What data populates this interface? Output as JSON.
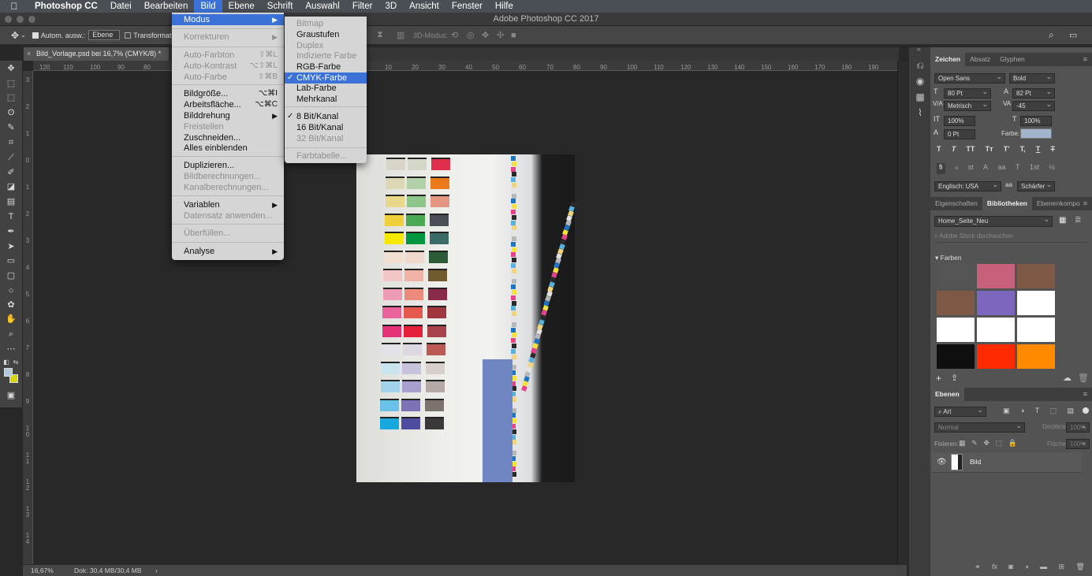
{
  "menubar": {
    "apple_icon": "apple-icon",
    "app_name": "Photoshop CC",
    "items": [
      "Datei",
      "Bearbeiten",
      "Bild",
      "Ebene",
      "Schrift",
      "Auswahl",
      "Filter",
      "3D",
      "Ansicht",
      "Fenster",
      "Hilfe"
    ]
  },
  "window": {
    "title": "Adobe Photoshop CC 2017"
  },
  "options": {
    "auto_select": "Autom. ausw.:",
    "layer_select": "Ebene",
    "transform": "Transformat",
    "mode_3d": "3D-Modus:"
  },
  "document": {
    "tab_title": "Bild_Vorlage.psd bei 16,7% (CMYK/8) *",
    "close_glyph": "×"
  },
  "ruler": {
    "h_ticks": [
      "120",
      "110",
      "100",
      "90",
      "80",
      "10",
      "20",
      "30",
      "40",
      "50",
      "60",
      "70",
      "80",
      "90",
      "100",
      "110",
      "120",
      "130",
      "140",
      "150",
      "160",
      "170",
      "180",
      "190"
    ],
    "v_ticks": [
      "3",
      "2",
      "1",
      "0",
      "1",
      "2",
      "3",
      "4",
      "5",
      "6",
      "7",
      "8",
      "9",
      "1 0",
      "1 1",
      "1 2",
      "1 3",
      "1 4"
    ]
  },
  "status": {
    "zoom": "16,67%",
    "doc": "Dok: 30,4 MB/30,4 MB",
    "arrow": "›"
  },
  "bild_menu": {
    "items": [
      {
        "label": "Modus",
        "submenu": true,
        "highlight": true
      },
      {
        "label": "Korrekturen",
        "submenu": true,
        "disabled": true
      },
      {
        "label": "Auto-Farbton",
        "shortcut": "⇧⌘L",
        "disabled": true
      },
      {
        "label": "Auto-Kontrast",
        "shortcut": "⌥⇧⌘L",
        "disabled": true
      },
      {
        "label": "Auto-Farbe",
        "shortcut": "⇧⌘B",
        "disabled": true
      },
      {
        "label": "Bildgröße...",
        "shortcut": "⌥⌘I"
      },
      {
        "label": "Arbeitsfläche...",
        "shortcut": "⌥⌘C"
      },
      {
        "label": "Bilddrehung",
        "submenu": true
      },
      {
        "label": "Freistellen",
        "disabled": true
      },
      {
        "label": "Zuschneiden..."
      },
      {
        "label": "Alles einblenden"
      },
      {
        "label": "Duplizieren..."
      },
      {
        "label": "Bildberechnungen...",
        "disabled": true
      },
      {
        "label": "Kanalberechnungen...",
        "disabled": true
      },
      {
        "label": "Variablen",
        "submenu": true
      },
      {
        "label": "Datensatz anwenden...",
        "disabled": true
      },
      {
        "label": "Überfüllen...",
        "disabled": true
      },
      {
        "label": "Analyse",
        "submenu": true
      }
    ],
    "submenu_arrow": "▶"
  },
  "modus_menu": {
    "items": [
      {
        "label": "Bitmap",
        "disabled": true
      },
      {
        "label": "Graustufen"
      },
      {
        "label": "Duplex",
        "disabled": true
      },
      {
        "label": "Indizierte Farbe",
        "disabled": true
      },
      {
        "label": "RGB-Farbe"
      },
      {
        "label": "CMYK-Farbe",
        "checked": true,
        "highlight": true
      },
      {
        "label": "Lab-Farbe"
      },
      {
        "label": "Mehrkanal"
      },
      {
        "label": "8 Bit/Kanal",
        "checked": true
      },
      {
        "label": "16 Bit/Kanal"
      },
      {
        "label": "32 Bit/Kanal",
        "disabled": true
      },
      {
        "label": "Farbtabelle...",
        "disabled": true
      }
    ],
    "check_glyph": "✓"
  },
  "char_panel": {
    "tabs": [
      "Zeichen",
      "Absatz",
      "Glyphen"
    ],
    "font": "Open Sans",
    "style": "Bold",
    "size": "80 Pt",
    "leading": "82 Pt",
    "kerning": "Metrisch",
    "tracking": "-45",
    "vscale": "100%",
    "hscale": "100%",
    "baseline": "0 Pt",
    "color_label": "Farbe:",
    "color": "#a2b4cc",
    "language": "Englisch: USA",
    "aa_label": "aa",
    "antialias": "Schärfer",
    "type_buttons": [
      "T",
      "T",
      "TT",
      "Tт",
      "T'",
      "T,",
      "T",
      "T"
    ],
    "ot_buttons": [
      "fi",
      "ℴ",
      "st",
      "A",
      "aa",
      "T",
      "1st",
      "½"
    ]
  },
  "lib_panel": {
    "tabs": [
      "Eigenschaften",
      "Bibliotheken",
      "Ebenenkompo"
    ],
    "library": "Home_Seite_Neu",
    "search_placeholder": "Adobe Stock durchsuchen",
    "section": "Farben",
    "swatches": [
      "#555555",
      "#c7607a",
      "#7e5a46",
      "#7e5a46",
      "#7c66be",
      "#ffffff",
      "#ffffff",
      "#ffffff",
      "#ffffff",
      "#0f0f0f",
      "#ff2a00",
      "#ff8a00"
    ]
  },
  "layers_panel": {
    "tab": "Ebenen",
    "filter": "Art",
    "blend": "Normal",
    "opacity_label": "Deckkraft:",
    "opacity": "100%",
    "lock_label": "Fixieren:",
    "fill_label": "Fläche:",
    "fill": "100%",
    "layer_name": "Bild"
  },
  "image": {
    "left_col": [
      "#d8d4c9",
      "#dcd7b4",
      "#ead88a",
      "#eed13a",
      "#f6e900",
      "#f1dfd2",
      "#f2c6c7",
      "#ee9bb6",
      "#e9649a",
      "#e43477",
      "#e2e2e8",
      "#c9e3ef",
      "#a2d3ea",
      "#6ac2e8",
      "#17a8df"
    ],
    "mid_col": [
      "#d2d7c7",
      "#b3d1a8",
      "#8dc58b",
      "#4da856",
      "#00953f",
      "#f0d8cd",
      "#efb2a5",
      "#ec8a7c",
      "#e6594f",
      "#e4203b",
      "#ddd7e2",
      "#c8c2dc",
      "#a99fcf",
      "#7e72b6",
      "#4d4ca0"
    ],
    "right_col": [
      "#e02e4d",
      "#eb7a1b",
      "#e59682",
      "#4a4e57",
      "#3c6a66",
      "#2c5b37",
      "#6f5b2e",
      "#8b2b49",
      "#a0363e",
      "#a8424b",
      "#bb5955",
      "#d6cfcb",
      "#b4a9a6",
      "#7c726e",
      "#3a3838"
    ],
    "strip": [
      "#1c75c3",
      "#f6e23a",
      "#e7428b",
      "#2a2a2a",
      "#56b0e0",
      "#f2d27a",
      "#e3e3e3",
      "#b5b8ba"
    ]
  }
}
